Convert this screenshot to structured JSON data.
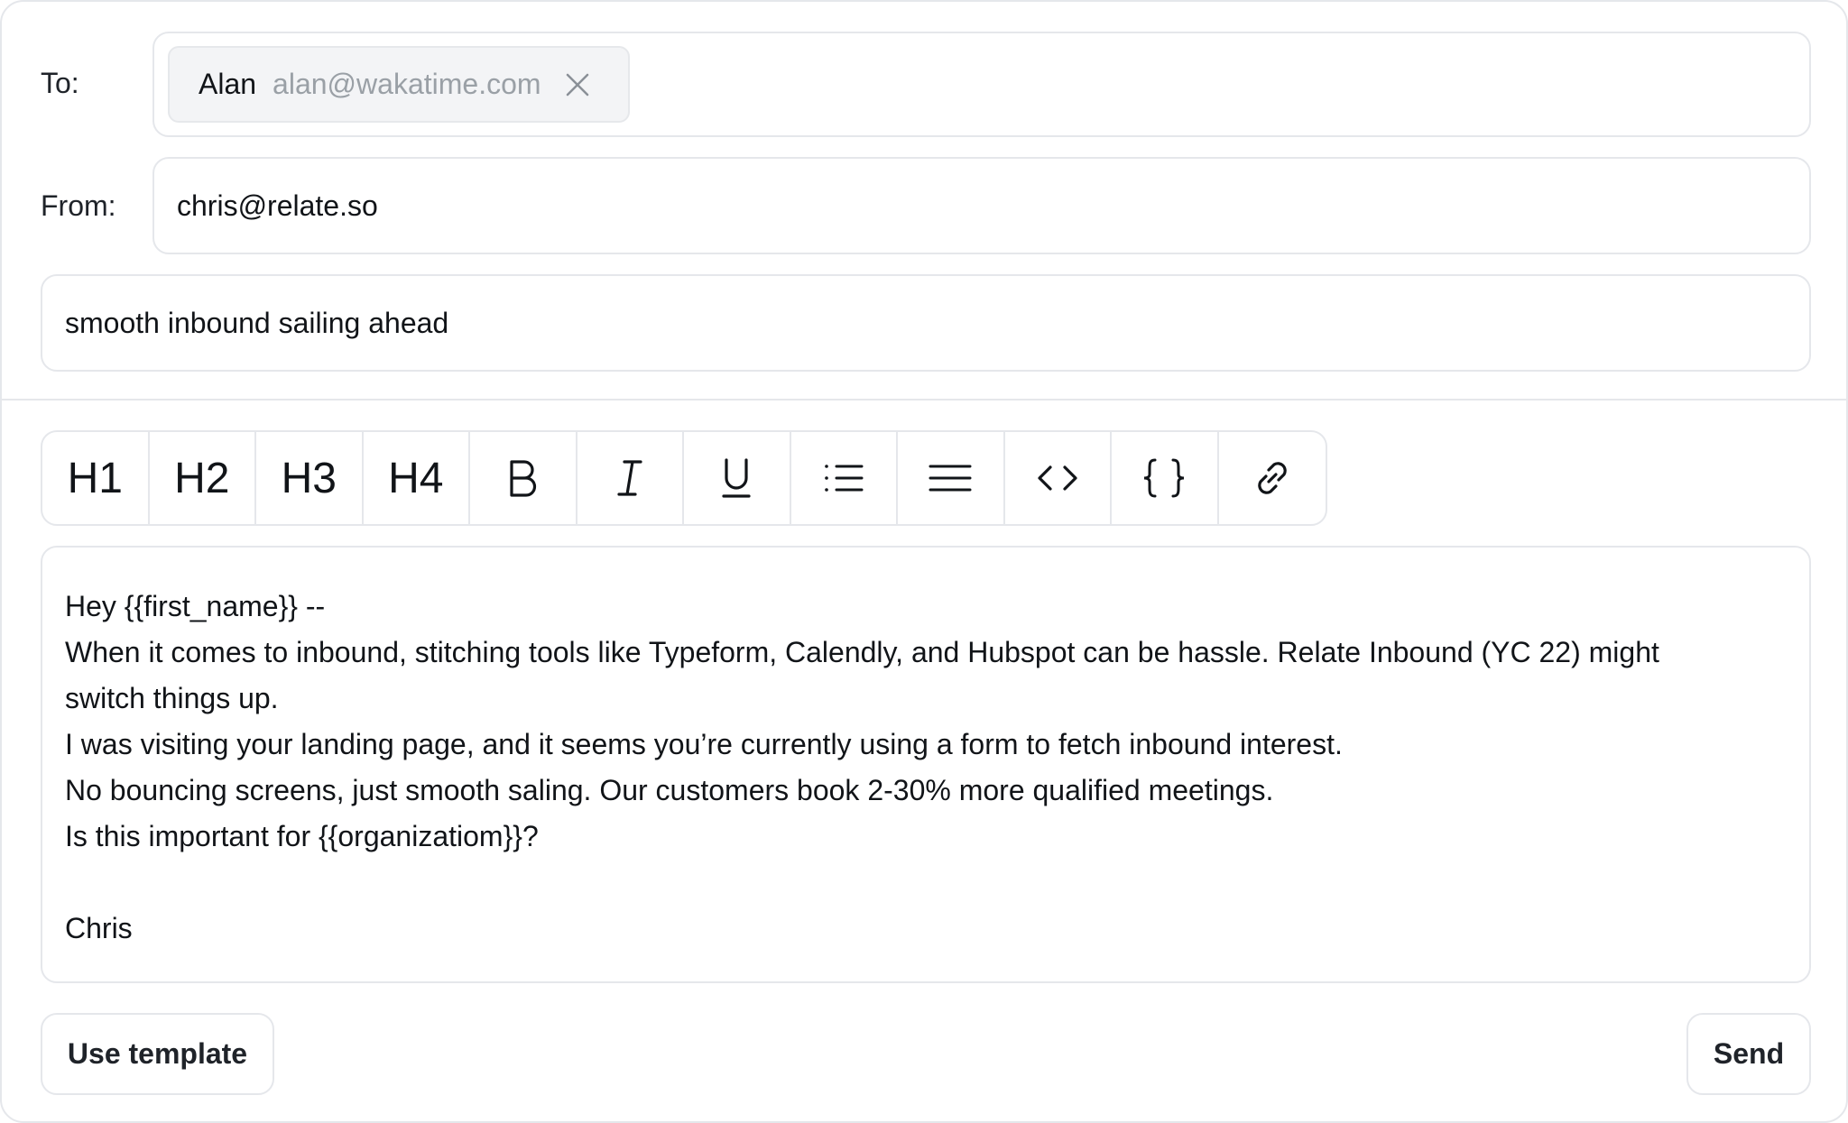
{
  "to": {
    "label": "To:",
    "recipient_name": "Alan",
    "recipient_email": "alan@wakatime.com"
  },
  "from": {
    "label": "From:",
    "value": "chris@relate.so"
  },
  "subject": {
    "value": "smooth inbound sailing ahead"
  },
  "toolbar": {
    "h1": "H1",
    "h2": "H2",
    "h3": "H3",
    "h4": "H4",
    "icons": [
      "bold-icon",
      "italic-icon",
      "underline-icon",
      "bullet-list-icon",
      "align-icon",
      "code-icon",
      "variable-braces-icon",
      "link-icon"
    ]
  },
  "body": {
    "lines": [
      "Hey {{first_name}} --",
      "When it comes to inbound, stitching tools like Typeform, Calendly, and Hubspot can be hassle. Relate Inbound (YC 22) might",
      "switch things up.",
      "I was visiting your landing page, and it seems you’re currently using a form to fetch inbound interest.",
      "No bouncing screens, just smooth saling. Our customers book 2-30% more qualified meetings.",
      "Is this important for {{organizatiom}}?",
      "",
      "Chris"
    ]
  },
  "actions": {
    "use_template": "Use template",
    "send": "Send"
  }
}
